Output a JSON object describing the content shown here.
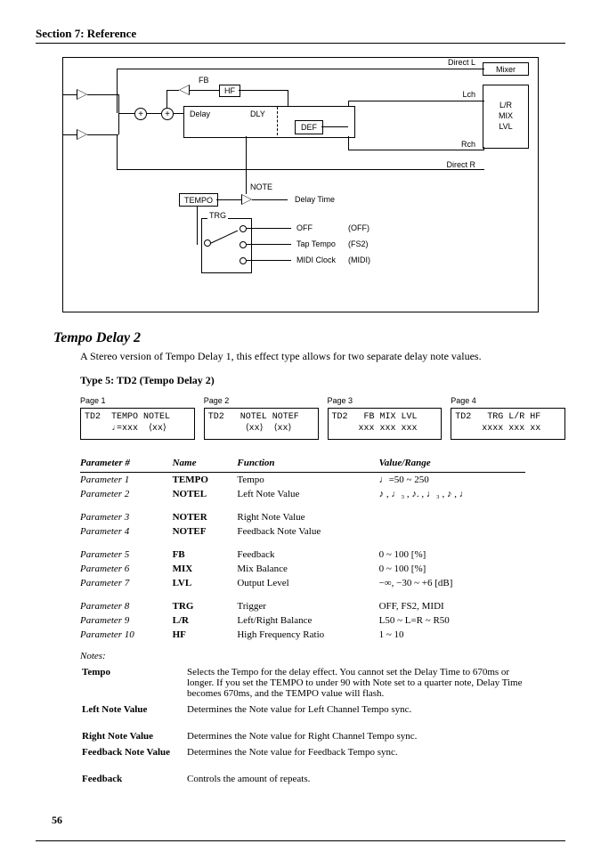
{
  "section_header": "Section 7: Reference",
  "diagram": {
    "direct_l": "Direct L",
    "direct_r": "Direct R",
    "mixer": "Mixer",
    "fb": "FB",
    "hf": "HF",
    "delay": "Delay",
    "dly": "DLY",
    "def": "DEF",
    "lch": "Lch",
    "rch": "Rch",
    "lr_mix_lvl": "L/R\nMIX\nLVL",
    "note": "NOTE",
    "tempo": "TEMPO",
    "delay_time": "Delay Time",
    "trg": "TRG",
    "off": "OFF",
    "off_code": "(OFF)",
    "tap_tempo": "Tap Tempo",
    "fs2": "(FS2)",
    "midi_clock": "MIDI Clock",
    "midi": "(MIDI)"
  },
  "title": "Tempo Delay 2",
  "intro": "A Stereo version of Tempo Delay 1, this effect type allows for two separate delay note values.",
  "subtitle": "Type 5: TD2 (Tempo Delay 2)",
  "pages": [
    {
      "label": "Page 1",
      "line1": "TD2  TEMPO NOTEL",
      "line2": "     ♩=xxx  ⟨xx⟩"
    },
    {
      "label": "Page 2",
      "line1": "TD2   NOTEL NOTEF",
      "line2": "       ⟨xx⟩  ⟨xx⟩"
    },
    {
      "label": "Page 3",
      "line1": "TD2   FB MIX LVL",
      "line2": "     xxx xxx xxx"
    },
    {
      "label": "Page 4",
      "line1": "TD2   TRG L/R HF",
      "line2": "     xxxx xxx xx"
    }
  ],
  "headers": {
    "p": "Parameter #",
    "n": "Name",
    "f": "Function",
    "v": "Value/Range"
  },
  "params": [
    {
      "p": "Parameter 1",
      "n": "TEMPO",
      "f": "Tempo",
      "v": "♩=50 ~ 250"
    },
    {
      "p": "Parameter 2",
      "n": "NOTEL",
      "f": "Left Note Value",
      "v": "♪ , ♩₃ , ♪. , ♩₃ , ♪ , ♩"
    },
    {
      "gap": true
    },
    {
      "p": "Parameter 3",
      "n": "NOTER",
      "f": "Right Note Value",
      "v": ""
    },
    {
      "p": "Parameter 4",
      "n": "NOTEF",
      "f": "Feedback Note Value",
      "v": ""
    },
    {
      "gap": true
    },
    {
      "p": "Parameter 5",
      "n": "FB",
      "f": "Feedback",
      "v": "0 ~ 100 [%]"
    },
    {
      "p": "Parameter 6",
      "n": "MIX",
      "f": "Mix Balance",
      "v": "0 ~ 100 [%]"
    },
    {
      "p": "Parameter 7",
      "n": "LVL",
      "f": "Output Level",
      "v": "−∞, −30 ~ +6 [dB]"
    },
    {
      "gap": true
    },
    {
      "p": "Parameter 8",
      "n": "TRG",
      "f": "Trigger",
      "v": "OFF, FS2, MIDI"
    },
    {
      "p": "Parameter 9",
      "n": "L/R",
      "f": "Left/Right Balance",
      "v": "L50 ~ L=R ~ R50"
    },
    {
      "p": "Parameter 10",
      "n": "HF",
      "f": "High Frequency Ratio",
      "v": "1 ~ 10"
    }
  ],
  "notes_header": "Notes:",
  "notes": [
    {
      "l": "Tempo",
      "t": "Selects the Tempo for the delay effect. You cannot set the Delay Time to 670ms or longer. If you set the TEMPO to under 90 with Note set to a quarter note, Delay Time becomes 670ms, and the TEMPO value will flash."
    },
    {
      "l": "Left Note Value",
      "t": "Determines the Note value for Left Channel Tempo sync."
    },
    {
      "gap": true
    },
    {
      "l": "Right Note Value",
      "t": "Determines the Note value for Right Channel Tempo sync."
    },
    {
      "l": "Feedback Note Value",
      "t": "Determines the Note value for Feedback Tempo sync."
    },
    {
      "gap": true
    },
    {
      "l": "Feedback",
      "t": "Controls the amount of repeats."
    }
  ],
  "pagenum": "56"
}
